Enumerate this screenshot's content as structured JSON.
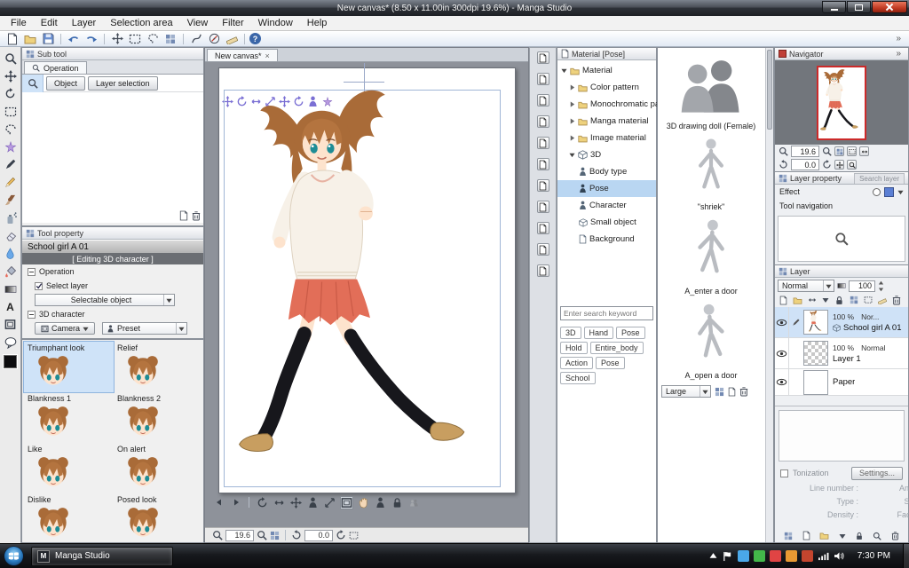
{
  "window": {
    "title": "New canvas* (8.50 x 11.00in 300dpi 19.6%) - Manga Studio"
  },
  "chrome": {
    "overflow": "»",
    "tab_close": "×",
    "help": "?"
  },
  "menu": {
    "items": [
      "File",
      "Edit",
      "Layer",
      "Selection area",
      "View",
      "Filter",
      "Window",
      "Help"
    ]
  },
  "canvas": {
    "tab": "New canvas*",
    "zoom": "19.6",
    "rotation": "0.0"
  },
  "subtool": {
    "title": "Sub tool",
    "tab": "Operation",
    "object_btn": "Object",
    "layer_sel_btn": "Layer selection"
  },
  "tool_property": {
    "title": "Tool property",
    "tool_name": "School girl A 01",
    "editing": "[ Editing 3D character ]",
    "operation": "Operation",
    "select_layer": "Select layer",
    "selectable_object": "Selectable object",
    "character_3d": "3D character",
    "camera": "Camera",
    "preset": "Preset"
  },
  "expressions": {
    "items": [
      "Triumphant look",
      "Relief",
      "Blankness 1",
      "Blankness 2",
      "Like",
      "On alert",
      "Dislike",
      "Posed look"
    ]
  },
  "material": {
    "title": "Material [Pose]",
    "root": "Material",
    "children": [
      "Color pattern",
      "Monochromatic patt",
      "Manga material",
      "Image material"
    ],
    "folder_3d": "3D",
    "children_3d": [
      "Body type",
      "Pose",
      "Character",
      "Small object",
      "Background"
    ],
    "search_placeholder": "Enter search keyword",
    "tags": [
      "3D",
      "Hand",
      "Pose",
      "Hold",
      "Entire_body",
      "Action",
      "Pose",
      "School"
    ],
    "items": [
      "3D drawing doll (Female)",
      "\"shriek\"",
      "A_enter a door",
      "A_open a door"
    ],
    "size": "Large"
  },
  "navigator": {
    "title": "Navigator",
    "zoom": "19.6",
    "rotation": "0.0"
  },
  "layer_property": {
    "title": "Layer property",
    "search_tab": "Search layer",
    "effect": "Effect",
    "tool_navigation": "Tool navigation"
  },
  "layer": {
    "title": "Layer",
    "blend": "Normal",
    "opacity": "100",
    "rows": [
      {
        "opacity": "100 %",
        "mode": "Nor...",
        "name": "School girl A 01"
      },
      {
        "opacity": "100 %",
        "mode": "Normal",
        "name": "Layer 1"
      },
      {
        "opacity": "",
        "mode": "",
        "name": "Paper"
      }
    ]
  },
  "tone": {
    "tonization": "Tonization",
    "settings": "Settings...",
    "rows": [
      {
        "left": "Line number :",
        "right": "Angle :"
      },
      {
        "left": "Type :",
        "right": "Size :"
      },
      {
        "left": "Density :",
        "right": "Factor :"
      }
    ]
  },
  "tools": {
    "text_tool": "A"
  },
  "taskbar": {
    "app": "Manga Studio",
    "app_letter": "M",
    "time": "7:30 PM"
  }
}
